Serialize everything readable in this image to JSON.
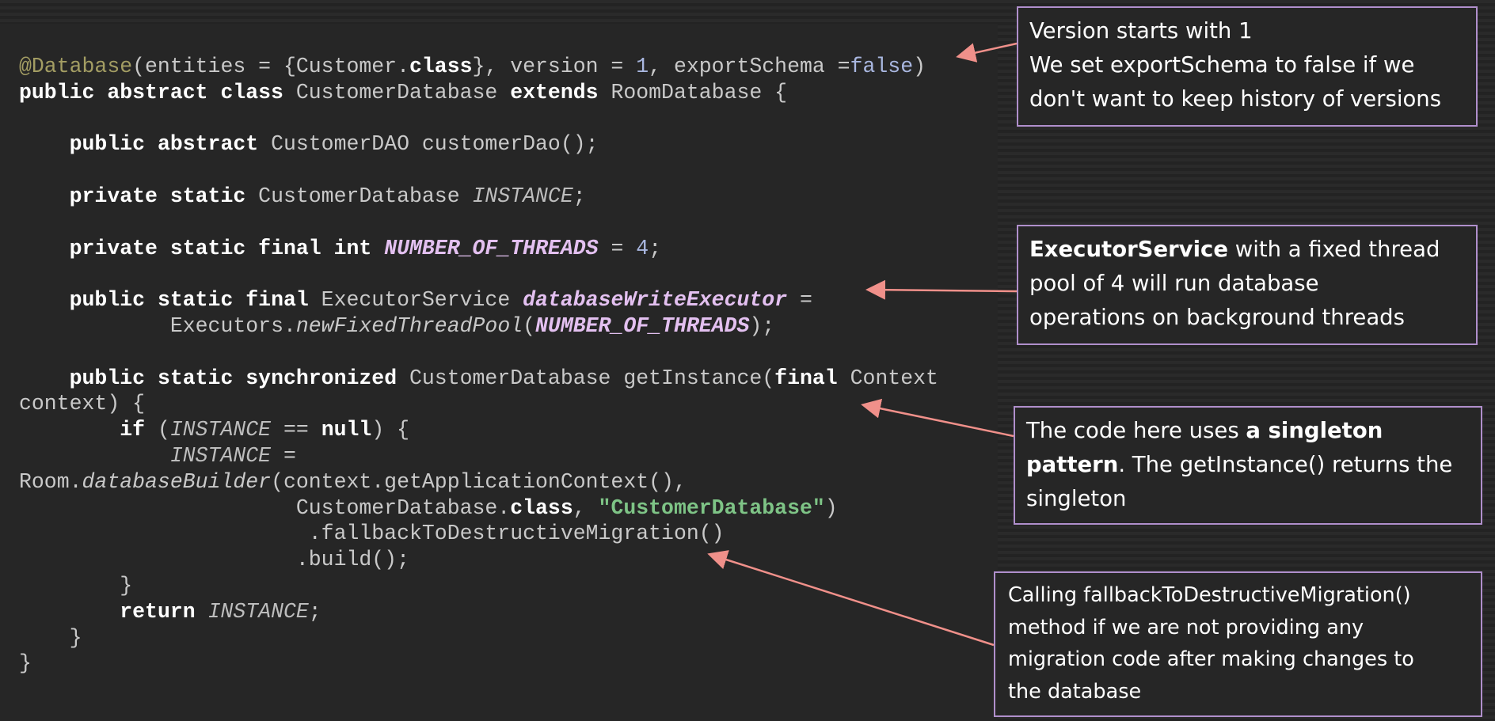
{
  "code": {
    "line1": {
      "anno": "@Database",
      "a": "(entities = {Customer.",
      "cls": "class",
      "b": "}, version = ",
      "ver": "1",
      "c": ", exportSchema =",
      "f": "false",
      ")": ")"
    },
    "line2": {
      "kw1": "public abstract class",
      "a": " CustomerDatabase ",
      "kw2": "extends",
      "b": " RoomDatabase {"
    },
    "line4": {
      "ind": "    ",
      "kw": "public abstract",
      "a": " CustomerDAO customerDao();"
    },
    "line6": {
      "ind": "    ",
      "kw": "private static",
      "a": " CustomerDatabase ",
      "inst": "INSTANCE",
      "b": ";"
    },
    "line8": {
      "ind": "    ",
      "kw": "private static final int",
      "a": " ",
      "const": "NUMBER_OF_THREADS",
      "b": " = ",
      "num": "4",
      "c": ";"
    },
    "line10": {
      "ind": "    ",
      "kw": "public static final",
      "a": " ExecutorService ",
      "field": "databaseWriteExecutor",
      "b": " ="
    },
    "line11": {
      "ind": "            ",
      "a": "Executors.",
      "m": "newFixedThreadPool",
      "b": "(",
      "const": "NUMBER_OF_THREADS",
      "c": ");"
    },
    "line13": {
      "ind": "    ",
      "kw": "public static synchronized",
      "a": " CustomerDatabase getInstance(",
      "kw2": "final",
      "b": " Context"
    },
    "line14": {
      "a": "context) {"
    },
    "line15": {
      "ind": "        ",
      "kw": "if",
      "a": " (",
      "inst": "INSTANCE",
      "b": " == ",
      "kw2": "null",
      "c": ") {"
    },
    "line16": {
      "ind": "            ",
      "inst": "INSTANCE",
      "a": " ="
    },
    "line17": {
      "a": "Room.",
      "m": "databaseBuilder",
      "b": "(context.getApplicationContext(),"
    },
    "line18": {
      "ind": "                      ",
      "a": "CustomerDatabase.",
      "cls": "class",
      "b": ", ",
      "str": "\"CustomerDatabase\"",
      "c": ")"
    },
    "line19": {
      "ind": "                       ",
      "a": ".fallbackToDestructiveMigration()"
    },
    "line20": {
      "ind": "                      ",
      "a": ".build();"
    },
    "line21": {
      "ind": "        ",
      "a": "}"
    },
    "line22": {
      "ind": "        ",
      "kw": "return",
      "a": " ",
      "inst": "INSTANCE",
      "b": ";"
    },
    "line23": {
      "ind": "    ",
      "a": "}"
    },
    "line24": {
      "a": "}"
    }
  },
  "callouts": {
    "version": {
      "line1": "Version starts with 1",
      "line2": "We set exportSchema to false if we",
      "line3": "don't want to keep history of versions"
    },
    "executor": {
      "bold": "ExecutorService",
      "line1_rest": " with a fixed thread",
      "line2": "pool of 4 will run database",
      "line3": "operations on background threads"
    },
    "singleton": {
      "line1_pre": "The code here uses ",
      "line1_bold": "a singleton",
      "line2_bold": "pattern",
      "line2_rest": ". The getInstance() returns the",
      "line3": "singleton"
    },
    "fallback": {
      "line1": "Calling fallbackToDestructiveMigration()",
      "line2": "method if we are not providing any",
      "line3": "migration code after making changes to",
      "line4": "the database"
    }
  },
  "colors": {
    "arrow": "#f0908a",
    "border": "#b08fcc"
  }
}
